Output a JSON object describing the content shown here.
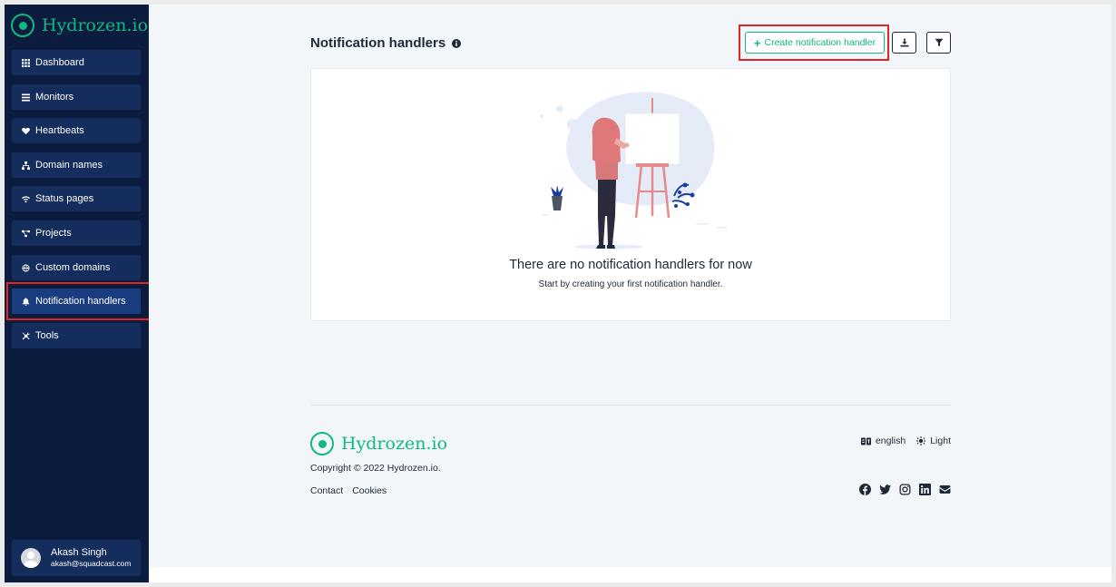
{
  "brand": {
    "name": "Hydrozen.io",
    "color": "#10b981"
  },
  "sidebar": {
    "items": [
      {
        "label": "Dashboard",
        "icon": "grid-icon"
      },
      {
        "label": "Monitors",
        "icon": "list-icon"
      },
      {
        "label": "Heartbeats",
        "icon": "heartbeat-icon"
      },
      {
        "label": "Domain names",
        "icon": "network-icon"
      },
      {
        "label": "Status pages",
        "icon": "wifi-icon"
      },
      {
        "label": "Projects",
        "icon": "project-diagram-icon"
      },
      {
        "label": "Custom domains",
        "icon": "globe-icon"
      },
      {
        "label": "Notification handlers",
        "icon": "bell-icon",
        "active": true
      },
      {
        "label": "Tools",
        "icon": "tools-icon"
      }
    ],
    "user": {
      "name": "Akash Singh",
      "email": "akash@squadcast.com"
    }
  },
  "main": {
    "title": "Notification handlers",
    "create_button": "Create notification handler",
    "export_icon": "download-icon",
    "filter_icon": "filter-icon",
    "empty_state": {
      "title": "There are no notification handlers for now",
      "subtitle": "Start by creating your first notification handler."
    }
  },
  "footer": {
    "brand": "Hydrozen.io",
    "copyright": "Copyright © 2022 Hydrozen.io.",
    "links": [
      "Contact",
      "Cookies"
    ],
    "language": "english",
    "theme": "Light",
    "socials": [
      "facebook-icon",
      "twitter-icon",
      "instagram-icon",
      "linkedin-icon",
      "envelope-icon"
    ]
  },
  "colors": {
    "sidebar_bg": "#0c1c3e",
    "nav_item_bg": "#142d5c",
    "accent_green": "#10b981",
    "highlight_red": "#e02424",
    "page_bg": "#f3f6f9"
  }
}
